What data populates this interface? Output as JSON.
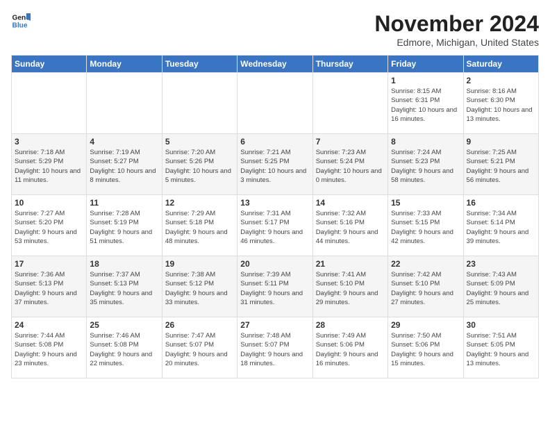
{
  "logo": {
    "line1": "General",
    "line2": "Blue"
  },
  "title": "November 2024",
  "location": "Edmore, Michigan, United States",
  "days_header": [
    "Sunday",
    "Monday",
    "Tuesday",
    "Wednesday",
    "Thursday",
    "Friday",
    "Saturday"
  ],
  "weeks": [
    [
      {
        "day": "",
        "info": ""
      },
      {
        "day": "",
        "info": ""
      },
      {
        "day": "",
        "info": ""
      },
      {
        "day": "",
        "info": ""
      },
      {
        "day": "",
        "info": ""
      },
      {
        "day": "1",
        "info": "Sunrise: 8:15 AM\nSunset: 6:31 PM\nDaylight: 10 hours and 16 minutes."
      },
      {
        "day": "2",
        "info": "Sunrise: 8:16 AM\nSunset: 6:30 PM\nDaylight: 10 hours and 13 minutes."
      }
    ],
    [
      {
        "day": "3",
        "info": "Sunrise: 7:18 AM\nSunset: 5:29 PM\nDaylight: 10 hours and 11 minutes."
      },
      {
        "day": "4",
        "info": "Sunrise: 7:19 AM\nSunset: 5:27 PM\nDaylight: 10 hours and 8 minutes."
      },
      {
        "day": "5",
        "info": "Sunrise: 7:20 AM\nSunset: 5:26 PM\nDaylight: 10 hours and 5 minutes."
      },
      {
        "day": "6",
        "info": "Sunrise: 7:21 AM\nSunset: 5:25 PM\nDaylight: 10 hours and 3 minutes."
      },
      {
        "day": "7",
        "info": "Sunrise: 7:23 AM\nSunset: 5:24 PM\nDaylight: 10 hours and 0 minutes."
      },
      {
        "day": "8",
        "info": "Sunrise: 7:24 AM\nSunset: 5:23 PM\nDaylight: 9 hours and 58 minutes."
      },
      {
        "day": "9",
        "info": "Sunrise: 7:25 AM\nSunset: 5:21 PM\nDaylight: 9 hours and 56 minutes."
      }
    ],
    [
      {
        "day": "10",
        "info": "Sunrise: 7:27 AM\nSunset: 5:20 PM\nDaylight: 9 hours and 53 minutes."
      },
      {
        "day": "11",
        "info": "Sunrise: 7:28 AM\nSunset: 5:19 PM\nDaylight: 9 hours and 51 minutes."
      },
      {
        "day": "12",
        "info": "Sunrise: 7:29 AM\nSunset: 5:18 PM\nDaylight: 9 hours and 48 minutes."
      },
      {
        "day": "13",
        "info": "Sunrise: 7:31 AM\nSunset: 5:17 PM\nDaylight: 9 hours and 46 minutes."
      },
      {
        "day": "14",
        "info": "Sunrise: 7:32 AM\nSunset: 5:16 PM\nDaylight: 9 hours and 44 minutes."
      },
      {
        "day": "15",
        "info": "Sunrise: 7:33 AM\nSunset: 5:15 PM\nDaylight: 9 hours and 42 minutes."
      },
      {
        "day": "16",
        "info": "Sunrise: 7:34 AM\nSunset: 5:14 PM\nDaylight: 9 hours and 39 minutes."
      }
    ],
    [
      {
        "day": "17",
        "info": "Sunrise: 7:36 AM\nSunset: 5:13 PM\nDaylight: 9 hours and 37 minutes."
      },
      {
        "day": "18",
        "info": "Sunrise: 7:37 AM\nSunset: 5:13 PM\nDaylight: 9 hours and 35 minutes."
      },
      {
        "day": "19",
        "info": "Sunrise: 7:38 AM\nSunset: 5:12 PM\nDaylight: 9 hours and 33 minutes."
      },
      {
        "day": "20",
        "info": "Sunrise: 7:39 AM\nSunset: 5:11 PM\nDaylight: 9 hours and 31 minutes."
      },
      {
        "day": "21",
        "info": "Sunrise: 7:41 AM\nSunset: 5:10 PM\nDaylight: 9 hours and 29 minutes."
      },
      {
        "day": "22",
        "info": "Sunrise: 7:42 AM\nSunset: 5:10 PM\nDaylight: 9 hours and 27 minutes."
      },
      {
        "day": "23",
        "info": "Sunrise: 7:43 AM\nSunset: 5:09 PM\nDaylight: 9 hours and 25 minutes."
      }
    ],
    [
      {
        "day": "24",
        "info": "Sunrise: 7:44 AM\nSunset: 5:08 PM\nDaylight: 9 hours and 23 minutes."
      },
      {
        "day": "25",
        "info": "Sunrise: 7:46 AM\nSunset: 5:08 PM\nDaylight: 9 hours and 22 minutes."
      },
      {
        "day": "26",
        "info": "Sunrise: 7:47 AM\nSunset: 5:07 PM\nDaylight: 9 hours and 20 minutes."
      },
      {
        "day": "27",
        "info": "Sunrise: 7:48 AM\nSunset: 5:07 PM\nDaylight: 9 hours and 18 minutes."
      },
      {
        "day": "28",
        "info": "Sunrise: 7:49 AM\nSunset: 5:06 PM\nDaylight: 9 hours and 16 minutes."
      },
      {
        "day": "29",
        "info": "Sunrise: 7:50 AM\nSunset: 5:06 PM\nDaylight: 9 hours and 15 minutes."
      },
      {
        "day": "30",
        "info": "Sunrise: 7:51 AM\nSunset: 5:05 PM\nDaylight: 9 hours and 13 minutes."
      }
    ]
  ]
}
